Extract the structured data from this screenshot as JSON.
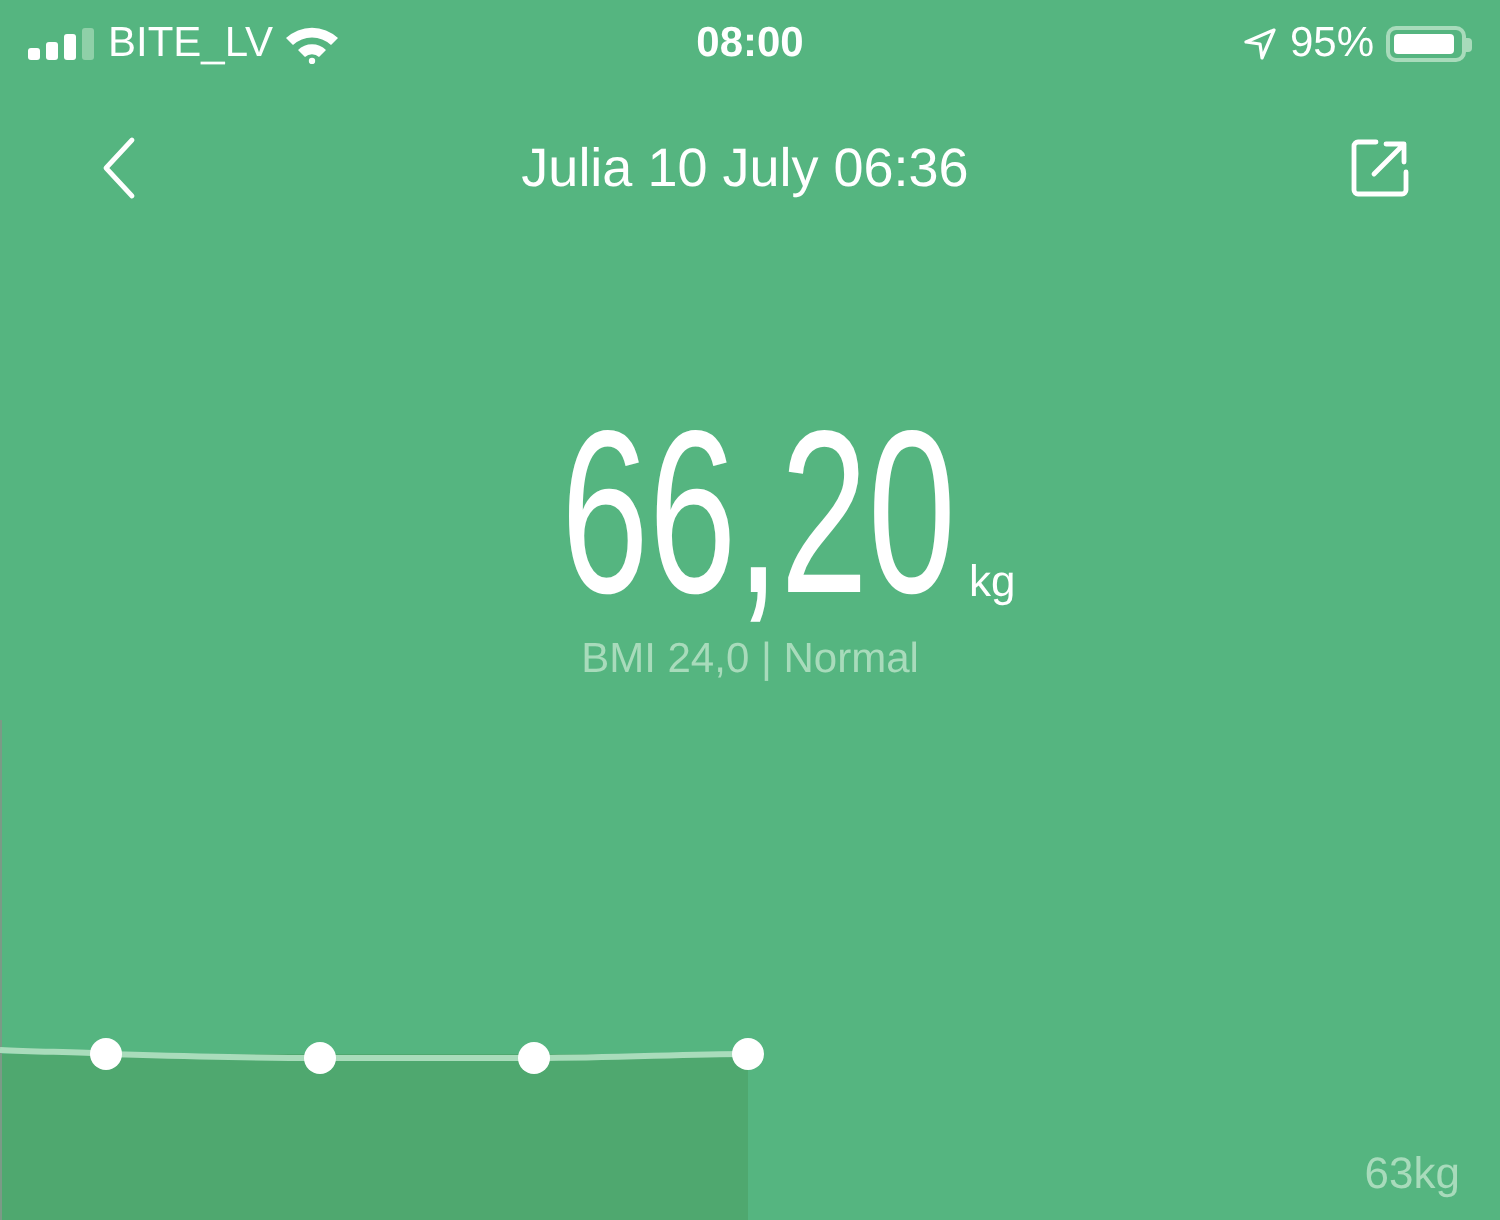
{
  "status_bar": {
    "carrier": "BITE_LV",
    "time": "08:00",
    "battery": "95%"
  },
  "nav": {
    "title": "Julia 10 July 06:36"
  },
  "measurement": {
    "value": "66,20",
    "unit": "kg",
    "bmi": "BMI 24,0 | Normal"
  },
  "trend": {
    "axis_label": "63kg"
  }
}
